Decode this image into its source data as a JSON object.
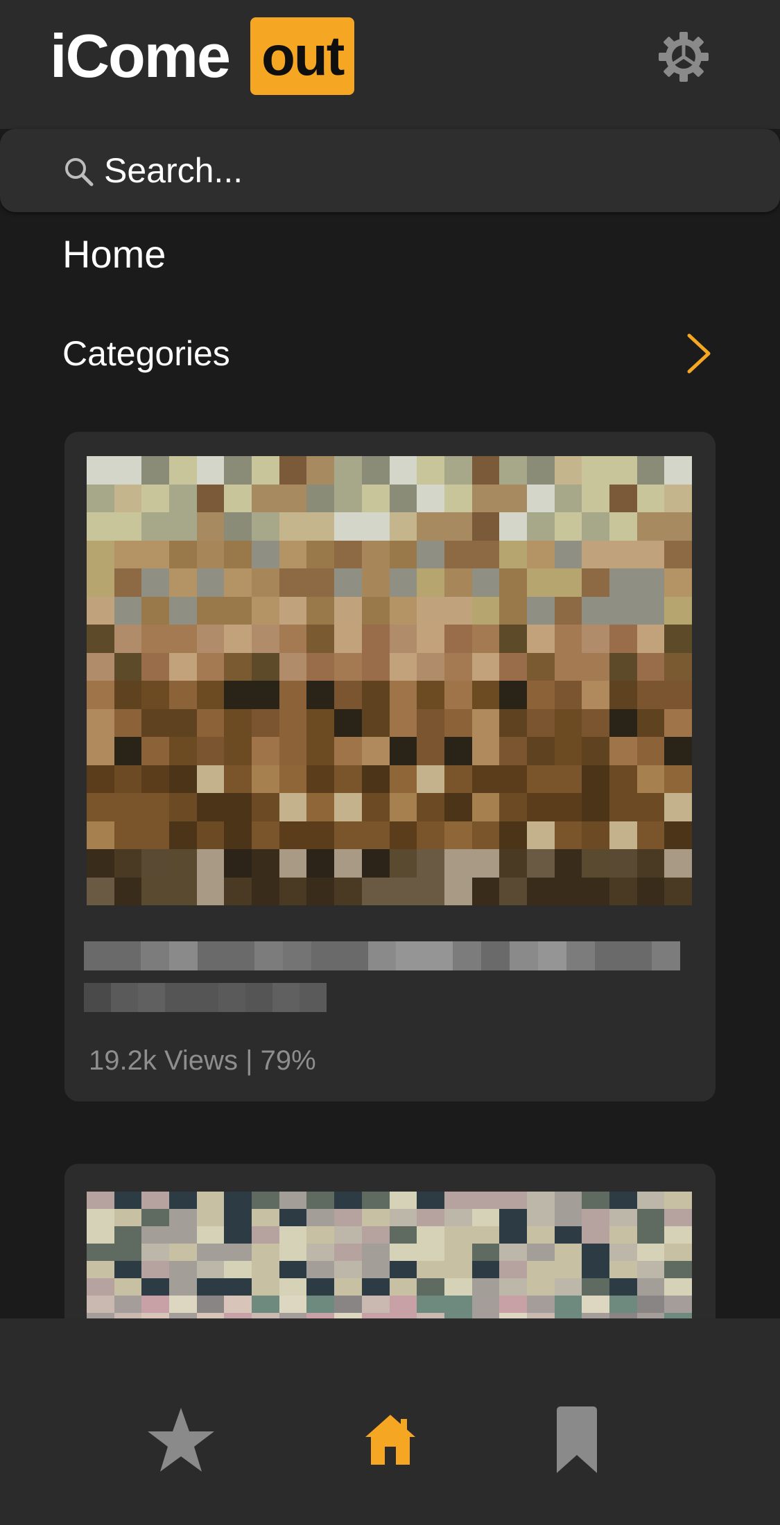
{
  "header": {
    "logo_text": "iCome",
    "logo_badge": "out",
    "brand_color": "#f5a623",
    "settings_icon": "gear-icon"
  },
  "search": {
    "placeholder": "Search..."
  },
  "page": {
    "title": "Home"
  },
  "categories": {
    "label": "Categories"
  },
  "videos": [
    {
      "title": "",
      "views": "19.2k Views",
      "separator": "|",
      "rating": "79%"
    },
    {
      "title": "",
      "views": "",
      "rating": ""
    }
  ],
  "bottom_nav": {
    "items": [
      {
        "icon": "star-icon",
        "active": false
      },
      {
        "icon": "home-icon",
        "active": true
      },
      {
        "icon": "bookmark-icon",
        "active": false
      }
    ],
    "active_color": "#f5a623",
    "inactive_color": "#8a8a8a"
  }
}
